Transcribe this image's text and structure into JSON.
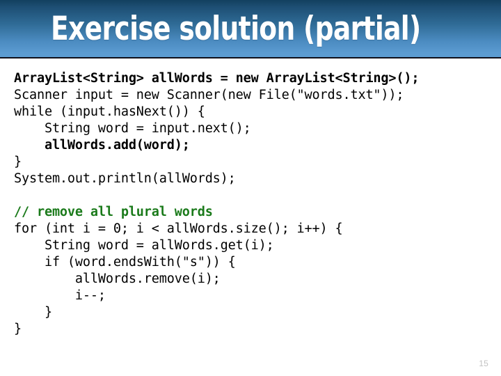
{
  "slide": {
    "title": "Exercise solution (partial)",
    "page_number": "15",
    "colors": {
      "banner_top": "#12405f",
      "banner_bottom": "#5c9cd2",
      "banner_rule": "#10101c",
      "title_text": "#ffffff",
      "code_text": "#000000",
      "comment_green": "#1a7a1a",
      "page_number_gray": "#c2c2c2",
      "background": "#ffffff"
    }
  },
  "code": {
    "lines": [
      {
        "text": "ArrayList<String> allWords = new ArrayList<String>();",
        "style": "bold"
      },
      {
        "text": "Scanner input = new Scanner(new File(\"words.txt\"));",
        "style": "normal"
      },
      {
        "text": "while (input.hasNext()) {",
        "style": "normal"
      },
      {
        "text": "    String word = input.next();",
        "style": "normal"
      },
      {
        "text": "    allWords.add(word);",
        "style": "bold"
      },
      {
        "text": "}",
        "style": "normal"
      },
      {
        "text": "System.out.println(allWords);",
        "style": "normal"
      },
      {
        "text": "",
        "style": "blank"
      },
      {
        "text": "// remove all plural words",
        "style": "comment"
      },
      {
        "text": "for (int i = 0; i < allWords.size(); i++) {",
        "style": "normal"
      },
      {
        "text": "    String word = allWords.get(i);",
        "style": "normal"
      },
      {
        "text": "    if (word.endsWith(\"s\")) {",
        "style": "normal"
      },
      {
        "text": "        allWords.remove(i);",
        "style": "normal"
      },
      {
        "text": "        i--;",
        "style": "normal"
      },
      {
        "text": "    }",
        "style": "normal"
      },
      {
        "text": "}",
        "style": "normal"
      }
    ]
  }
}
